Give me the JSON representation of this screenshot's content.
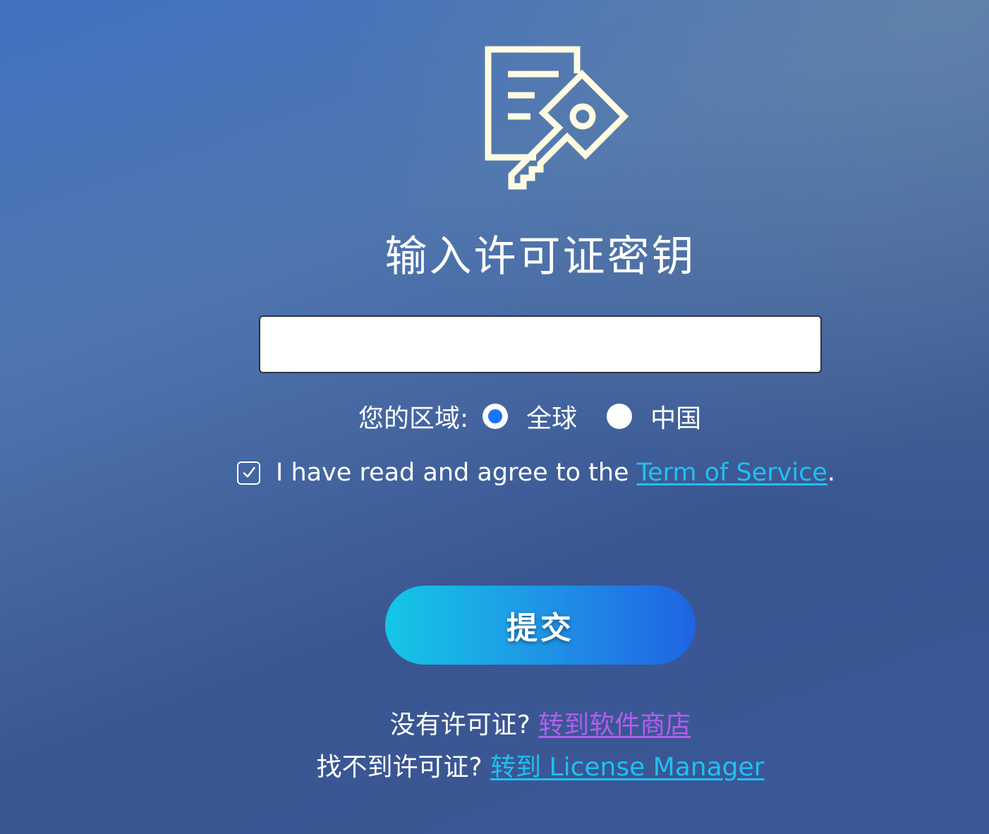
{
  "icon": {
    "name": "license-key-icon",
    "color": "#fffbe0"
  },
  "title": "输入许可证密钥",
  "license_input": {
    "value": "",
    "placeholder": ""
  },
  "region": {
    "label": "您的区域:",
    "options": [
      {
        "label": "全球",
        "selected": true
      },
      {
        "label": "中国",
        "selected": false
      }
    ],
    "selected_color": "#1874ff"
  },
  "agreement": {
    "checked": true,
    "text": "I have read and agree to the ",
    "link_text": "Term of Service",
    "suffix": "."
  },
  "submit": {
    "label": "提交"
  },
  "footer": {
    "no_license_text": "没有许可证? ",
    "no_license_link": "转到软件商店",
    "cant_find_text": "找不到许可证? ",
    "cant_find_link": "转到 License Manager"
  },
  "colors": {
    "link_cyan": "#1fc0f2",
    "link_purple": "#b55cf0",
    "button_start": "#14c7e6",
    "button_end": "#2063e4"
  }
}
